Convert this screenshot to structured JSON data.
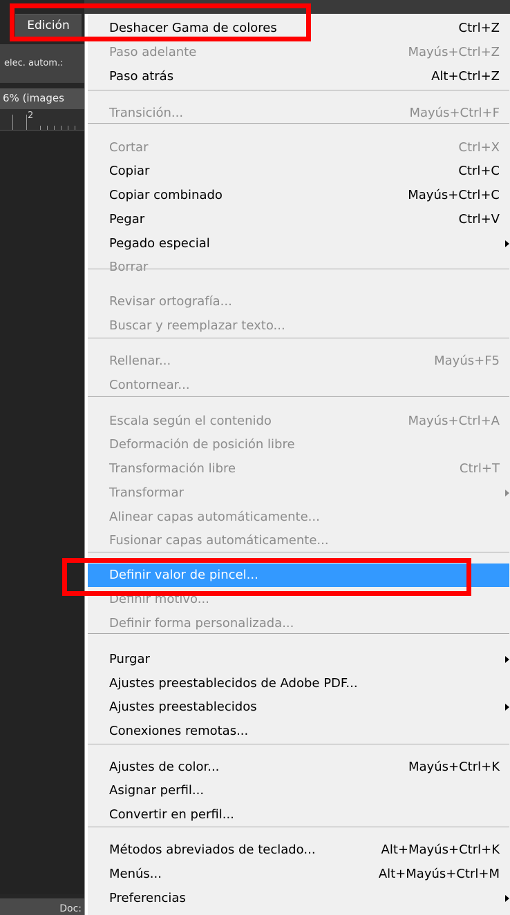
{
  "menubar": {
    "active_menu": "Edición"
  },
  "workspace": {
    "options_text": "elec. autom.:",
    "doc_tab_text": "6% (images",
    "ruler_number": "2",
    "status_text": "Doc:"
  },
  "menu": {
    "items": [
      {
        "label": "Deshacer Gama de colores",
        "shortcut": "Ctrl+Z",
        "enabled": true
      },
      {
        "label": "Paso adelante",
        "shortcut": "Mayús+Ctrl+Z",
        "enabled": false
      },
      {
        "label": "Paso atrás",
        "shortcut": "Alt+Ctrl+Z",
        "enabled": true
      },
      {
        "label": "Transición...",
        "shortcut": "Mayús+Ctrl+F",
        "enabled": false
      },
      {
        "label": "Cortar",
        "shortcut": "Ctrl+X",
        "enabled": false
      },
      {
        "label": "Copiar",
        "shortcut": "Ctrl+C",
        "enabled": true
      },
      {
        "label": "Copiar combinado",
        "shortcut": "Mayús+Ctrl+C",
        "enabled": true
      },
      {
        "label": "Pegar",
        "shortcut": "Ctrl+V",
        "enabled": true
      },
      {
        "label": "Pegado especial",
        "shortcut": "",
        "enabled": true,
        "submenu": true
      },
      {
        "label": "Borrar",
        "shortcut": "",
        "enabled": false
      },
      {
        "label": "Revisar ortografía...",
        "shortcut": "",
        "enabled": false
      },
      {
        "label": "Buscar y reemplazar texto...",
        "shortcut": "",
        "enabled": false
      },
      {
        "label": "Rellenar...",
        "shortcut": "Mayús+F5",
        "enabled": false
      },
      {
        "label": "Contornear...",
        "shortcut": "",
        "enabled": false
      },
      {
        "label": "Escala según el contenido",
        "shortcut": "Mayús+Ctrl+A",
        "enabled": false
      },
      {
        "label": "Deformación de posición libre",
        "shortcut": "",
        "enabled": false
      },
      {
        "label": "Transformación libre",
        "shortcut": "Ctrl+T",
        "enabled": false
      },
      {
        "label": "Transformar",
        "shortcut": "",
        "enabled": false,
        "submenu": true
      },
      {
        "label": "Alinear capas automáticamente...",
        "shortcut": "",
        "enabled": false
      },
      {
        "label": "Fusionar capas automáticamente...",
        "shortcut": "",
        "enabled": false
      },
      {
        "label": "Definir valor de pincel...",
        "shortcut": "",
        "enabled": true,
        "highlighted": true
      },
      {
        "label": "Definir motivo...",
        "shortcut": "",
        "enabled": false
      },
      {
        "label": "Definir forma personalizada...",
        "shortcut": "",
        "enabled": false
      },
      {
        "label": "Purgar",
        "shortcut": "",
        "enabled": true,
        "submenu": true
      },
      {
        "label": "Ajustes preestablecidos de Adobe PDF...",
        "shortcut": "",
        "enabled": true
      },
      {
        "label": "Ajustes preestablecidos",
        "shortcut": "",
        "enabled": true,
        "submenu": true
      },
      {
        "label": "Conexiones remotas...",
        "shortcut": "",
        "enabled": true
      },
      {
        "label": "Ajustes de color...",
        "shortcut": "Mayús+Ctrl+K",
        "enabled": true
      },
      {
        "label": "Asignar perfil...",
        "shortcut": "",
        "enabled": true
      },
      {
        "label": "Convertir en perfil...",
        "shortcut": "",
        "enabled": true
      },
      {
        "label": "Métodos abreviados de teclado...",
        "shortcut": "Alt+Mayús+Ctrl+K",
        "enabled": true
      },
      {
        "label": "Menús...",
        "shortcut": "Alt+Mayús+Ctrl+M",
        "enabled": true
      },
      {
        "label": "Preferencias",
        "shortcut": "",
        "enabled": true,
        "submenu": true
      }
    ]
  },
  "colors": {
    "menu_bg": "#f0f0f0",
    "highlight": "#3399ff",
    "annotation": "#ff0000",
    "disabled_text": "#8c8c8c"
  }
}
